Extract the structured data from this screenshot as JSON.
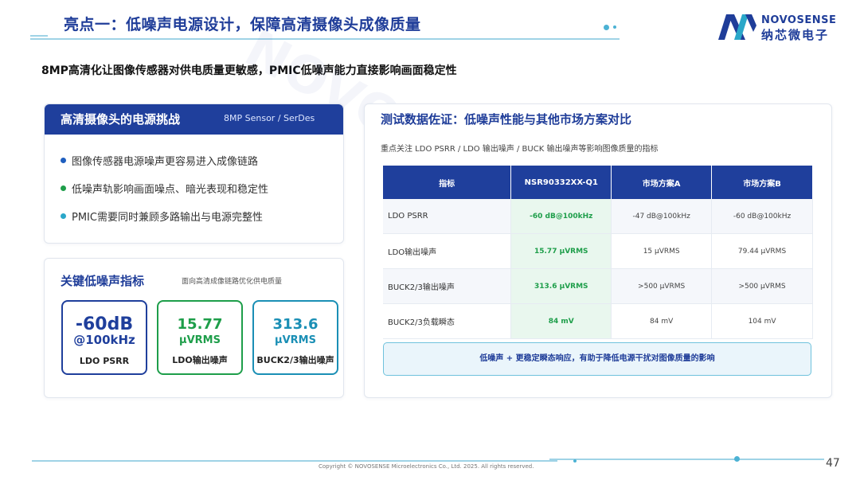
{
  "header": {
    "title": "亮点一：低噪声电源设计，保障高清摄像头成像质量",
    "logo_en": "NOVOSENSE",
    "logo_cn": "纳芯微电子"
  },
  "subtitle": "8MP高清化让图像传感器对供电质量更敏感，PMIC低噪声能力直接影响画面稳定性",
  "watermark": "NOVOSENSE 纳芯微电子",
  "challenge_card": {
    "title": "高清摄像头的电源挑战",
    "tag": "8MP Sensor / SerDes",
    "bullets": [
      {
        "text": "图像传感器电源噪声更容易进入成像链路",
        "color": "#1f5fbf"
      },
      {
        "text": "低噪声轨影响画面噪点、暗光表现和稳定性",
        "color": "#1e9e4a"
      },
      {
        "text": "PMIC需要同时兼顾多路输出与电源完整性",
        "color": "#2aa7c9"
      }
    ]
  },
  "metrics_card": {
    "title": "关键低噪声指标",
    "note": "面向高清成像链路优化供电质量",
    "metrics": [
      {
        "value": "-60dB",
        "unit": "@100kHz",
        "label": "LDO PSRR",
        "color": "#1f3f9c"
      },
      {
        "value": "15.77",
        "unit": "μVRMS",
        "label": "LDO输出噪声",
        "color": "#1e9e4a"
      },
      {
        "value": "313.6",
        "unit": "μVRMS",
        "label": "BUCK2/3输出噪声",
        "color": "#1a8fb5"
      }
    ]
  },
  "comparison": {
    "title": "测试数据佐证：低噪声性能与其他市场方案对比",
    "desc": "重点关注 LDO PSRR / LDO 输出噪声 / BUCK 输出噪声等影响图像质量的指标",
    "headers": [
      "指标",
      "NSR90332XX-Q1",
      "市场方案A",
      "市场方案B"
    ],
    "rows": [
      [
        "LDO PSRR",
        "-60 dB@100kHz",
        "-47 dB@100kHz",
        "-60 dB@100kHz"
      ],
      [
        "LDO输出噪声",
        "15.77 μVRMS",
        "15 μVRMS",
        "79.44 μVRMS"
      ],
      [
        "BUCK2/3输出噪声",
        "313.6 μVRMS",
        ">500 μVRMS",
        ">500 μVRMS"
      ],
      [
        "BUCK2/3负载瞬态",
        "84 mV",
        "84 mV",
        "104 mV"
      ]
    ],
    "footer": "低噪声 + 更稳定瞬态响应，有助于降低电源干扰对图像质量的影响"
  },
  "footer": {
    "copyright": "Copyright © NOVOSENSE Microelectronics Co., Ltd. 2025. All rights reserved.",
    "page": "47"
  }
}
